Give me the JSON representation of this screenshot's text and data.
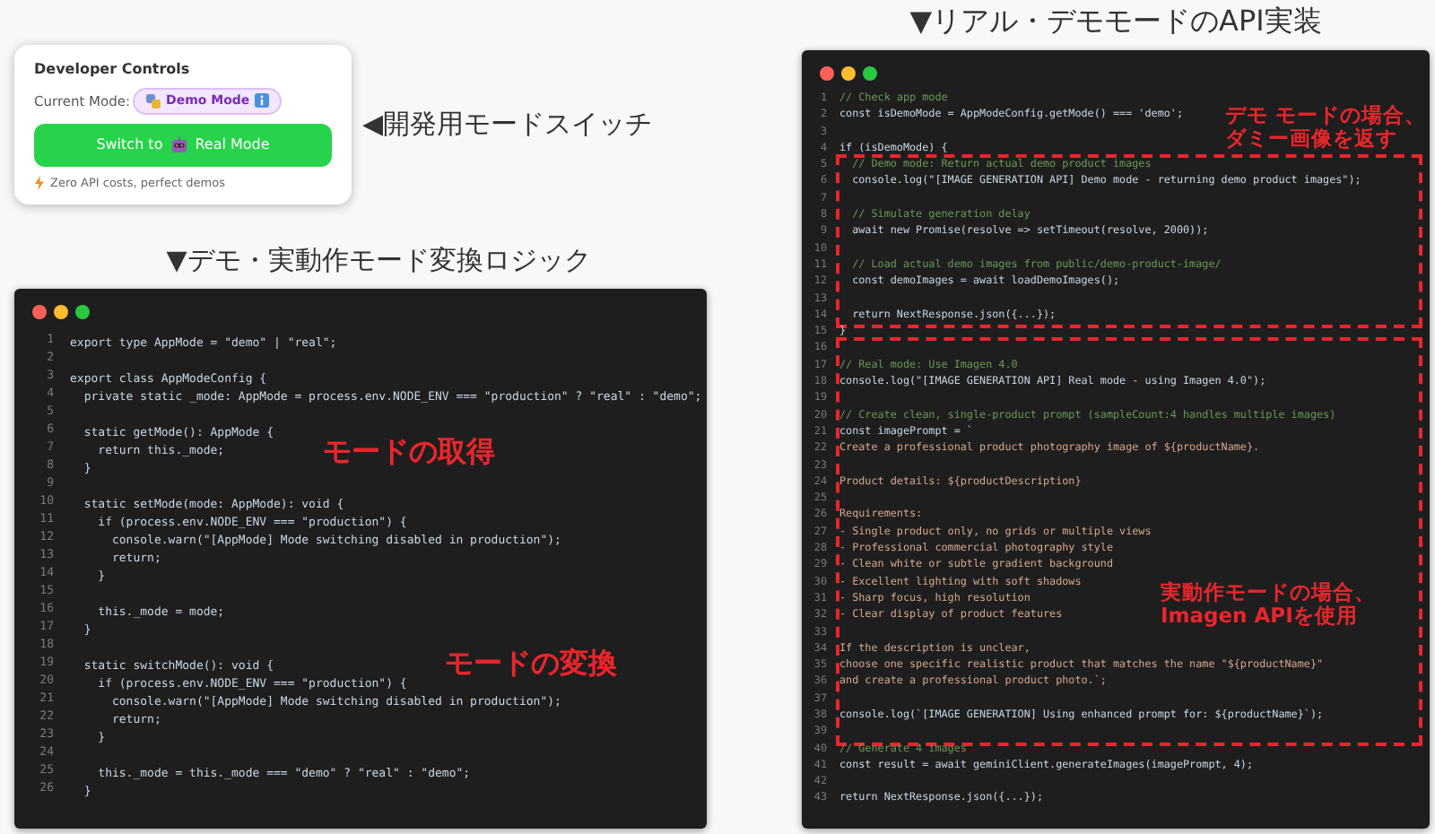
{
  "dev_controls": {
    "title": "Developer Controls",
    "mode_label": "Current Mode:",
    "mode_badge": "Demo Mode",
    "switch_button": {
      "before": "Switch to",
      "after": "Real Mode"
    },
    "hint": "Zero API costs, perfect demos"
  },
  "switch_caption": "◀開発用モードスイッチ",
  "logic_caption": "▼デモ・実動作モード変換ロジック",
  "logic_code": {
    "annotations": [
      {
        "lines": [
          "モードの取得"
        ]
      },
      {
        "lines": [
          "モードの変換"
        ]
      }
    ],
    "blocks": [
      {
        "highlighted": false,
        "lines": [
          {
            "n": "1",
            "kind": "code",
            "text": "export type AppMode = \"demo\" | \"real\";"
          },
          {
            "n": "2"
          },
          {
            "n": "3",
            "kind": "code",
            "text": "export class AppModeConfig {"
          },
          {
            "n": "4",
            "kind": "code",
            "text": "  private static _mode: AppMode = process.env.NODE_ENV === \"production\" ? \"real\" : \"demo\";"
          },
          {
            "n": "5"
          },
          {
            "n": "6",
            "kind": "code",
            "text": "  static getMode(): AppMode {"
          },
          {
            "n": "7",
            "kind": "code",
            "text": "    return this._mode;"
          },
          {
            "n": "8",
            "kind": "code",
            "text": "  }"
          },
          {
            "n": "9"
          },
          {
            "n": "10",
            "kind": "code",
            "text": "  static setMode(mode: AppMode): void {"
          },
          {
            "n": "11",
            "kind": "code",
            "text": "    if (process.env.NODE_ENV === \"production\") {"
          },
          {
            "n": "12",
            "kind": "code",
            "text": "      console.warn(\"[AppMode] Mode switching disabled in production\");"
          },
          {
            "n": "13",
            "kind": "code",
            "text": "      return;"
          },
          {
            "n": "14",
            "kind": "code",
            "text": "    }"
          },
          {
            "n": "15"
          },
          {
            "n": "16",
            "kind": "code",
            "text": "    this._mode = mode;"
          },
          {
            "n": "17",
            "kind": "code",
            "text": "  }"
          },
          {
            "n": "18"
          },
          {
            "n": "19",
            "kind": "code",
            "text": "  static switchMode(): void {"
          },
          {
            "n": "20",
            "kind": "code",
            "text": "    if (process.env.NODE_ENV === \"production\") {"
          },
          {
            "n": "21",
            "kind": "code",
            "text": "      console.warn(\"[AppMode] Mode switching disabled in production\");"
          },
          {
            "n": "22",
            "kind": "code",
            "text": "      return;"
          },
          {
            "n": "23",
            "kind": "code",
            "text": "    }"
          },
          {
            "n": "24"
          },
          {
            "n": "25",
            "kind": "code",
            "text": "    this._mode = this._mode === \"demo\" ? \"real\" : \"demo\";"
          },
          {
            "n": "26",
            "kind": "code",
            "text": "  }"
          }
        ]
      }
    ]
  },
  "api_caption": "▼リアル・デモモードのAPI実装",
  "api_code": {
    "annotations": [
      {
        "lines": [
          "デモ モードの場合、",
          "ダミー画像を返す"
        ]
      },
      {
        "lines": [
          "実動作モードの場合、",
          "Imagen APIを使用"
        ]
      }
    ],
    "blocks": [
      {
        "highlighted": false,
        "lines": [
          {
            "n": "1",
            "kind": "comment",
            "text": "// Check app mode"
          },
          {
            "n": "2",
            "kind": "code",
            "text": "const isDemoMode = AppModeConfig.getMode() === 'demo';"
          },
          {
            "n": "3"
          },
          {
            "n": "4",
            "kind": "code",
            "text": "if (isDemoMode) {"
          }
        ]
      },
      {
        "highlighted": true,
        "lines": [
          {
            "n": "5",
            "kind": "comment",
            "text": "  // Demo mode: Return actual demo product images"
          },
          {
            "n": "6",
            "kind": "code",
            "text": "  console.log(\"[IMAGE GENERATION API] Demo mode - returning demo product images\");"
          },
          {
            "n": "7"
          },
          {
            "n": "8",
            "kind": "comment",
            "text": "  // Simulate generation delay"
          },
          {
            "n": "9",
            "kind": "code",
            "text": "  await new Promise(resolve => setTimeout(resolve, 2000));"
          },
          {
            "n": "10"
          },
          {
            "n": "11",
            "kind": "comment",
            "text": "  // Load actual demo images from public/demo-product-image/"
          },
          {
            "n": "12",
            "kind": "code",
            "text": "  const demoImages = await loadDemoImages();"
          },
          {
            "n": "13"
          },
          {
            "n": "14",
            "kind": "code",
            "text": "  return NextResponse.json({...});"
          }
        ]
      },
      {
        "highlighted": false,
        "lines": [
          {
            "n": "15",
            "kind": "code",
            "text": "}"
          }
        ]
      },
      {
        "highlighted": true,
        "lines": [
          {
            "n": "16"
          },
          {
            "n": "17",
            "kind": "comment",
            "text": "// Real mode: Use Imagen 4.0"
          },
          {
            "n": "18",
            "kind": "code",
            "text": "console.log(\"[IMAGE GENERATION API] Real mode - using Imagen 4.0\");"
          },
          {
            "n": "19"
          },
          {
            "n": "20",
            "kind": "comment",
            "text": "// Create clean, single-product prompt (sampleCount:4 handles multiple images)"
          },
          {
            "n": "21",
            "kind": "code",
            "text": "const imagePrompt = `"
          },
          {
            "n": "22",
            "kind": "string",
            "text": "Create a professional product photography image of ${productName}."
          },
          {
            "n": "23"
          },
          {
            "n": "24",
            "kind": "string",
            "text": "Product details: ${productDescription}"
          },
          {
            "n": "25"
          },
          {
            "n": "26",
            "kind": "string",
            "text": "Requirements:"
          },
          {
            "n": "27",
            "kind": "string",
            "text": "- Single product only, no grids or multiple views"
          },
          {
            "n": "28",
            "kind": "string",
            "text": "- Professional commercial photography style"
          },
          {
            "n": "29",
            "kind": "string",
            "text": "- Clean white or subtle gradient background"
          },
          {
            "n": "30",
            "kind": "string",
            "text": "- Excellent lighting with soft shadows"
          },
          {
            "n": "31",
            "kind": "string",
            "text": "- Sharp focus, high resolution"
          },
          {
            "n": "32",
            "kind": "string",
            "text": "- Clear display of product features"
          },
          {
            "n": "33"
          },
          {
            "n": "34",
            "kind": "string",
            "text": "If the description is unclear,"
          },
          {
            "n": "35",
            "kind": "string",
            "text": "choose one specific realistic product that matches the name \"${productName}\""
          },
          {
            "n": "36",
            "kind": "string",
            "text": "and create a professional product photo.`;"
          },
          {
            "n": "37"
          },
          {
            "n": "38",
            "kind": "code",
            "text": "console.log(`[IMAGE GENERATION] Using enhanced prompt for: ${productName}`);"
          },
          {
            "n": "39"
          }
        ]
      },
      {
        "highlighted": false,
        "lines": [
          {
            "n": "40",
            "kind": "comment",
            "text": "// Generate 4 images"
          },
          {
            "n": "41",
            "kind": "code",
            "text": "const result = await geminiClient.generateImages(imagePrompt, 4);"
          },
          {
            "n": "42"
          },
          {
            "n": "43",
            "kind": "code",
            "text": "return NextResponse.json({...});"
          }
        ]
      }
    ]
  }
}
